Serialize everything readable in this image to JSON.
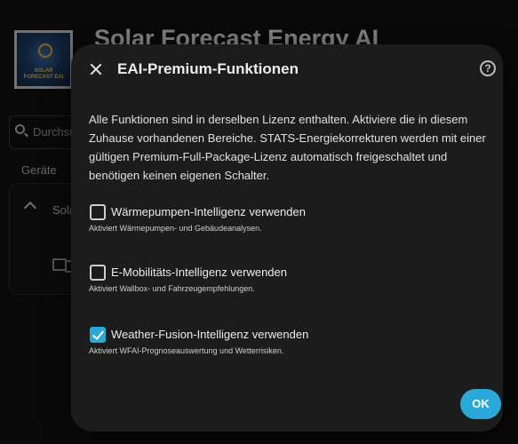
{
  "background": {
    "logo": {
      "line1": "SOLAR",
      "line2": "FORECAST EAI"
    },
    "title": "Solar Forecast Energy AI",
    "search_text": "Durchsu",
    "section_label": "Geräte",
    "card_label": "Solar"
  },
  "dialog": {
    "title": "EAI-Premium-Funktionen",
    "help_glyph": "?",
    "description": "Alle Funktionen sind in derselben Lizenz enthalten. Aktiviere die in diesem Zuhause vorhandenen Bereiche. STATS-Energiekorrekturen werden mit einer gültigen Premium-Full-Package-Lizenz automatisch freigeschaltet und benötigen keinen eigenen Schalter.",
    "options": [
      {
        "label": "Wärmepumpen-Intelligenz verwenden",
        "hint": "Aktiviert Wärmepumpen- und Gebäudeanalysen.",
        "checked": false
      },
      {
        "label": "E-Mobilitäts-Intelligenz verwenden",
        "hint": "Aktiviert Wallbox- und Fahrzeugempfehlungen.",
        "checked": false
      },
      {
        "label": "Weather-Fusion-Intelligenz verwenden",
        "hint": "Aktiviert WFAI-Prognoseauswertung und Wetterrisiken.",
        "checked": true
      }
    ],
    "ok_label": "OK"
  },
  "colors": {
    "accent": "#2aa8d8",
    "dialog_bg": "#1c1c1c",
    "page_bg": "#111111"
  }
}
